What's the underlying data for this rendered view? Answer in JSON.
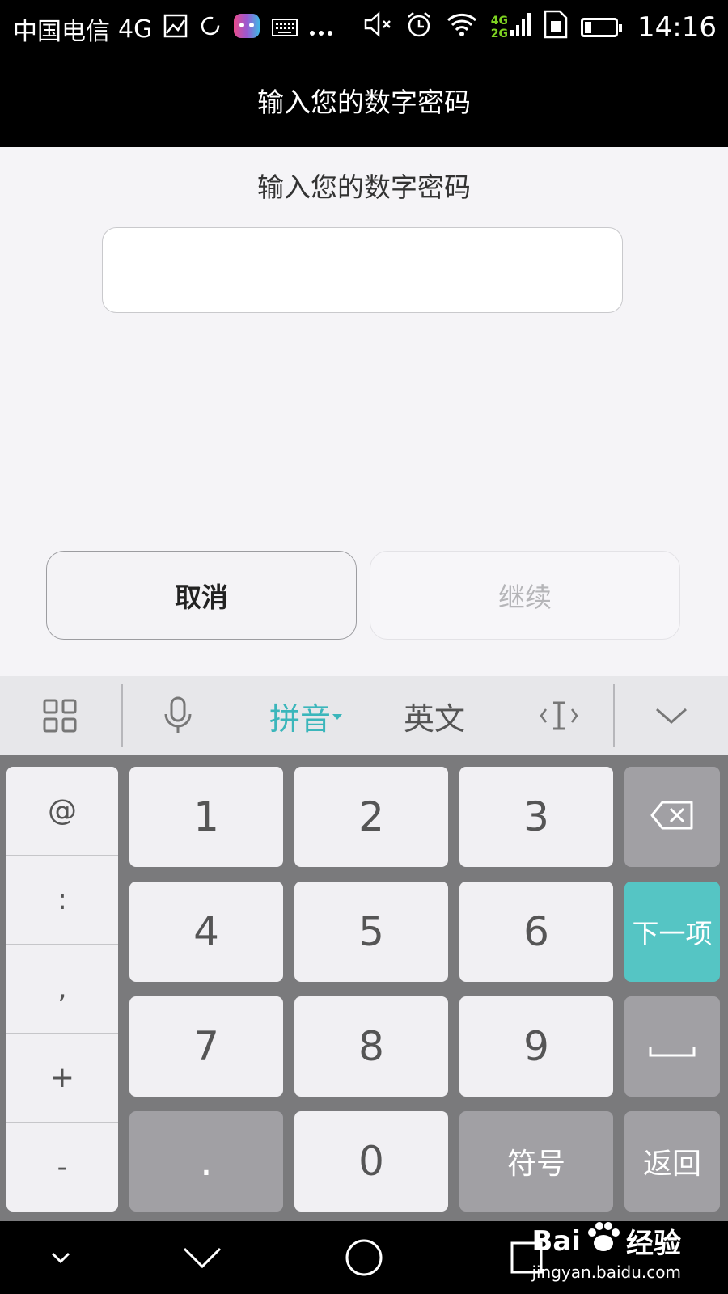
{
  "status_bar": {
    "carrier": "中国电信",
    "network": "4G",
    "signal_badge_top": "4G",
    "signal_badge_bottom": "2G",
    "time": "14:16",
    "icons": [
      "image-icon",
      "sync-icon",
      "game-icon",
      "keyboard-icon",
      "more-dots-icon",
      "mute-icon",
      "alarm-icon",
      "wifi-icon",
      "signal-icon",
      "sim-icon",
      "battery-icon"
    ]
  },
  "title_bar": {
    "title": "输入您的数字密码"
  },
  "main": {
    "prompt": "输入您的数字密码",
    "pin_value": "",
    "cancel_label": "取消",
    "continue_label": "继续"
  },
  "keyboard_toolbar": {
    "pinyin_label": "拼音",
    "english_label": "英文",
    "icons": [
      "grid-icon",
      "microphone-icon",
      "cursor-icon",
      "collapse-keyboard-icon"
    ]
  },
  "keyboard": {
    "symbols": [
      "@",
      ":",
      ",",
      "+",
      "-"
    ],
    "digits": [
      "1",
      "2",
      "3",
      "4",
      "5",
      "6",
      "7",
      "8",
      "9",
      "0"
    ],
    "dot": ".",
    "symbol_key": "符号",
    "next_key": "下一项",
    "back_key": "返回",
    "accent_color": "#55c5c4",
    "highlight_color": "#3bb6bb"
  },
  "watermark": {
    "brand_left": "Bai",
    "brand_right": "经验",
    "url": "jingyan.baidu.com"
  }
}
